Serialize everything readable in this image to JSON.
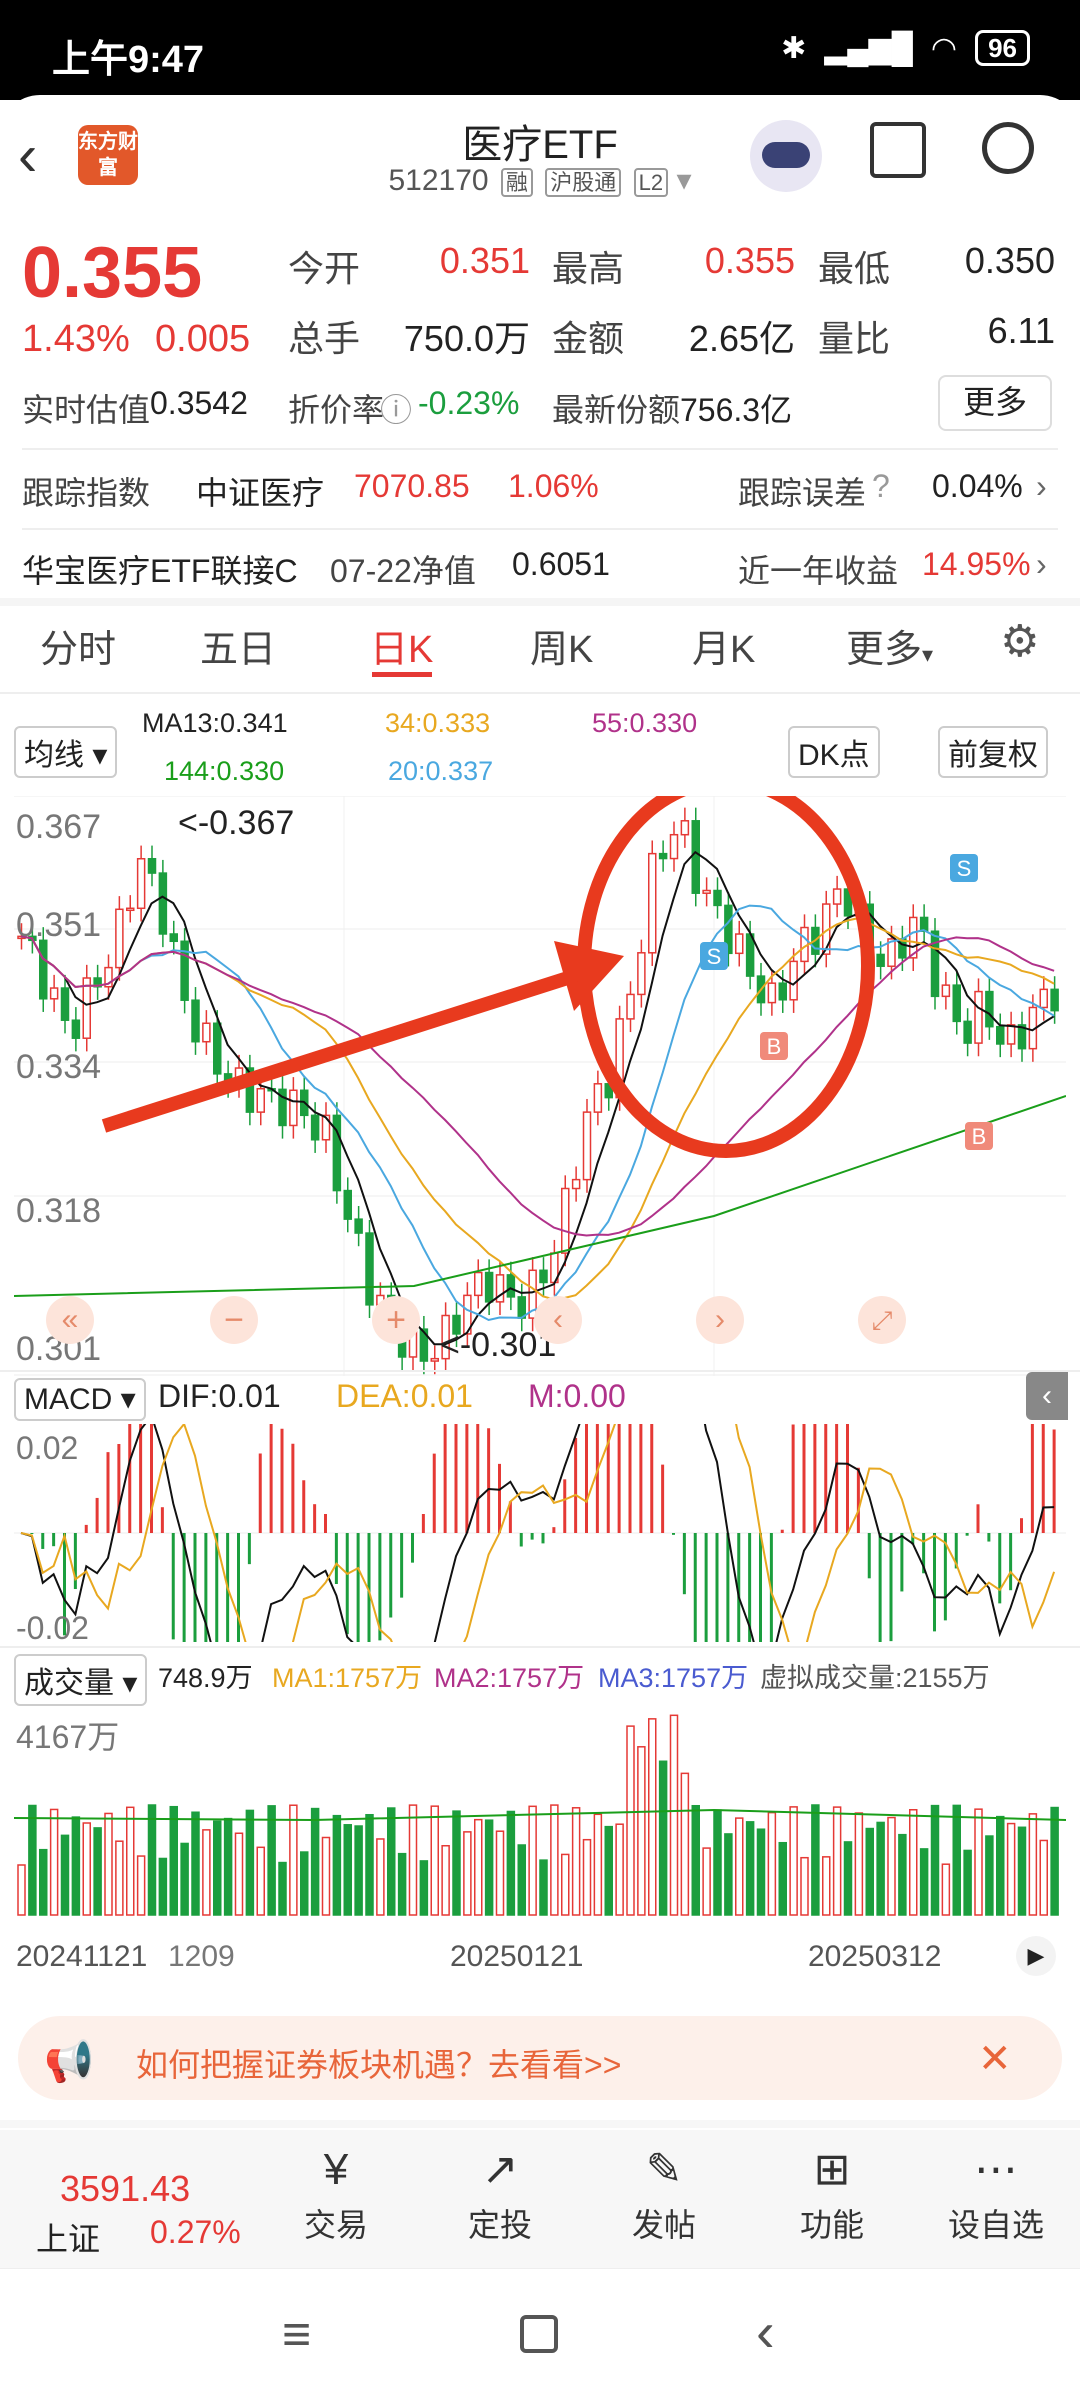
{
  "status": {
    "time": "上午9:47",
    "battery": "96"
  },
  "header": {
    "logo": "东方财富",
    "title": "医疗ETF",
    "code": "512170",
    "tags": [
      "融",
      "沪股通",
      "L2"
    ]
  },
  "quote": {
    "price": "0.355",
    "change_pct": "1.43%",
    "change": "0.005",
    "fields": [
      {
        "label": "今开",
        "value": "0.351",
        "color": "red"
      },
      {
        "label": "最高",
        "value": "0.355",
        "color": "red"
      },
      {
        "label": "最低",
        "value": "0.350",
        "color": "black"
      },
      {
        "label": "总手",
        "value": "750.0万",
        "color": "black"
      },
      {
        "label": "金额",
        "value": "2.65亿",
        "color": "black"
      },
      {
        "label": "量比",
        "value": "6.11",
        "color": "black"
      }
    ],
    "est_label": "实时估值",
    "est_value": "0.3542",
    "premium_label": "折价率",
    "premium_value": "-0.23%",
    "shares_label": "最新份额",
    "shares_value": "756.3亿",
    "more": "更多"
  },
  "tracking": {
    "label": "跟踪指数",
    "index": "中证医疗",
    "value": "7070.85",
    "pct": "1.06%",
    "err_label": "跟踪误差",
    "err_value": "0.04%"
  },
  "linked": {
    "name": "华宝医疗ETF联接C",
    "nav_label": "07-22净值",
    "nav": "0.6051",
    "year_label": "近一年收益",
    "year_value": "14.95%"
  },
  "tabs": [
    "分时",
    "五日",
    "日K",
    "周K",
    "月K",
    "更多"
  ],
  "active_tab": 2,
  "ma": {
    "selector": "均线",
    "ma13": "MA13:0.341",
    "ma34": "34:0.333",
    "ma55": "55:0.330",
    "ma144": "144:0.330",
    "ma20": "20:0.337",
    "dk": "DK点",
    "fq": "前复权"
  },
  "macd": {
    "selector": "MACD",
    "dif": "DIF:0.01",
    "dea": "DEA:0.01",
    "m": "M:0.00"
  },
  "vol": {
    "selector": "成交量",
    "v": "748.9万",
    "ma1": "MA1:1757万",
    "ma2": "MA2:1757万",
    "ma3": "MA3:1757万",
    "virtual": "虚拟成交量:2155万"
  },
  "chart_data": [
    {
      "type": "candlestick",
      "title": "",
      "yticks": [
        "0.367",
        "0.351",
        "0.334",
        "0.318",
        "0.301"
      ],
      "annotations": [
        "<-0.367",
        "<-0.301"
      ],
      "ylim": [
        0.301,
        0.367
      ]
    },
    {
      "type": "bar+line",
      "name": "MACD",
      "yticks": [
        "0.02",
        "-0.02"
      ],
      "ylim": [
        -0.02,
        0.02
      ]
    },
    {
      "type": "bar",
      "name": "成交量",
      "yticks": [
        "4167万"
      ],
      "xticks": [
        "20241121",
        "1209",
        "20250121",
        "20250312"
      ]
    }
  ],
  "banner": "如何把握证券板块机遇？去看看>>",
  "index": {
    "value": "3591.43",
    "name": "上证",
    "pct": "0.27%"
  },
  "nav": [
    {
      "label": "交易",
      "icon": "¥"
    },
    {
      "label": "定投",
      "icon": "↗"
    },
    {
      "label": "发帖",
      "icon": "✎"
    },
    {
      "label": "功能",
      "icon": "⊞"
    },
    {
      "label": "设自选",
      "icon": "⋯"
    }
  ]
}
